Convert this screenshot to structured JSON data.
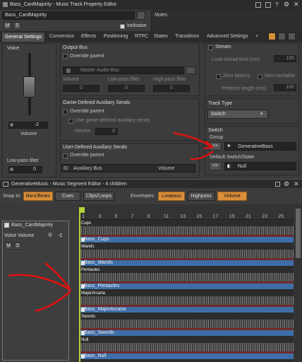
{
  "header": {
    "title": "Bass_CardMajority - Music Track Property Editor",
    "object_name": "Bass_CardMajority",
    "notes_label": "Notes",
    "m_label": "M",
    "s_label": "S",
    "inclusion_label": "Inclusion"
  },
  "tabs": [
    "General Settings",
    "Conversion",
    "Effects",
    "Positioning",
    "RTPC",
    "States",
    "Transitions",
    "Advanced Settings",
    "+"
  ],
  "voice": {
    "title": "Voice",
    "volume_value": "-2",
    "volume_label": "Volume",
    "lowpass_label": "Low-pass filter",
    "lowpass_value": "0"
  },
  "output_bus": {
    "title": "Output Bus",
    "override_label": "Override parent",
    "bus_name": "Master Audio Bus",
    "col_volume": "Volume",
    "col_lowpass": "Low-pass filter",
    "col_highpass": "High-pass filter",
    "volume_value": "0",
    "lowpass_value": "0",
    "highpass_value": "0",
    "more_label": "..."
  },
  "game_sends": {
    "title": "Game-Defined Auxiliary Sends",
    "override_label": "Override parent",
    "use_label": "Use game-defined auxiliary sends",
    "volume_label": "Volume",
    "volume_value": "0"
  },
  "user_sends": {
    "title": "User-Defined Auxiliary Sends",
    "override_label": "Override parent",
    "col_id": "ID",
    "col_bus": "Auxiliary Bus",
    "col_volume": "Volume"
  },
  "stream": {
    "title": "Stream",
    "lookahead_label": "Look-ahead time (ms)",
    "lookahead_value": "100",
    "zero_latency_label": "Zero latency",
    "non_cachable_label": "Non-cachable",
    "prefetch_label": "Prefetch length (ms)",
    "prefetch_value": "100"
  },
  "track_type": {
    "title": "Track Type",
    "value": "Switch"
  },
  "switch": {
    "title": "Switch",
    "group_label": "Group",
    "group_value": "GenerativeBass",
    "default_label": "Default Switch/State",
    "default_value": "Null",
    "arrow_btn": ">>"
  },
  "segment_editor": {
    "title": "GenerativeMusic - Music Segment Editor - 4 children",
    "snap_label": "Snap to:",
    "snap_value": "Bars/Beats",
    "cues_label": "Cues",
    "clips_label": "Clips/Loops",
    "envelopes_label": "Envelopes:",
    "lowpass_label": "Lowpass",
    "highpass_label": "Highpass",
    "volume_label": "Volume",
    "ruler": [
      "1",
      "3",
      "5",
      "7",
      "9",
      "11",
      "13",
      "15",
      "17",
      "19",
      "21",
      "23",
      "25"
    ],
    "track_name": "Bass_CardMajority",
    "voice_volume_label": "Voice Volume",
    "voice_volume_value": "-2",
    "m_label": "M",
    "s_label": "S",
    "lanes": [
      {
        "cue": "Cups",
        "clip": "Bass_Cups"
      },
      {
        "cue": "Wands",
        "clip": "Bass_Wands"
      },
      {
        "cue": "Pentacles",
        "clip": "Bass_Pentacles"
      },
      {
        "cue": "MajorArcana",
        "clip": "Bass_MajorArcana"
      },
      {
        "cue": "Swords",
        "clip": "Bass_Swords"
      },
      {
        "cue": "Null",
        "clip": "Bass_Null"
      }
    ]
  },
  "colors": {
    "accent_orange": "#d88e3a",
    "clip_blue": "#3e6ea8",
    "annotation_red": "#e01010"
  }
}
